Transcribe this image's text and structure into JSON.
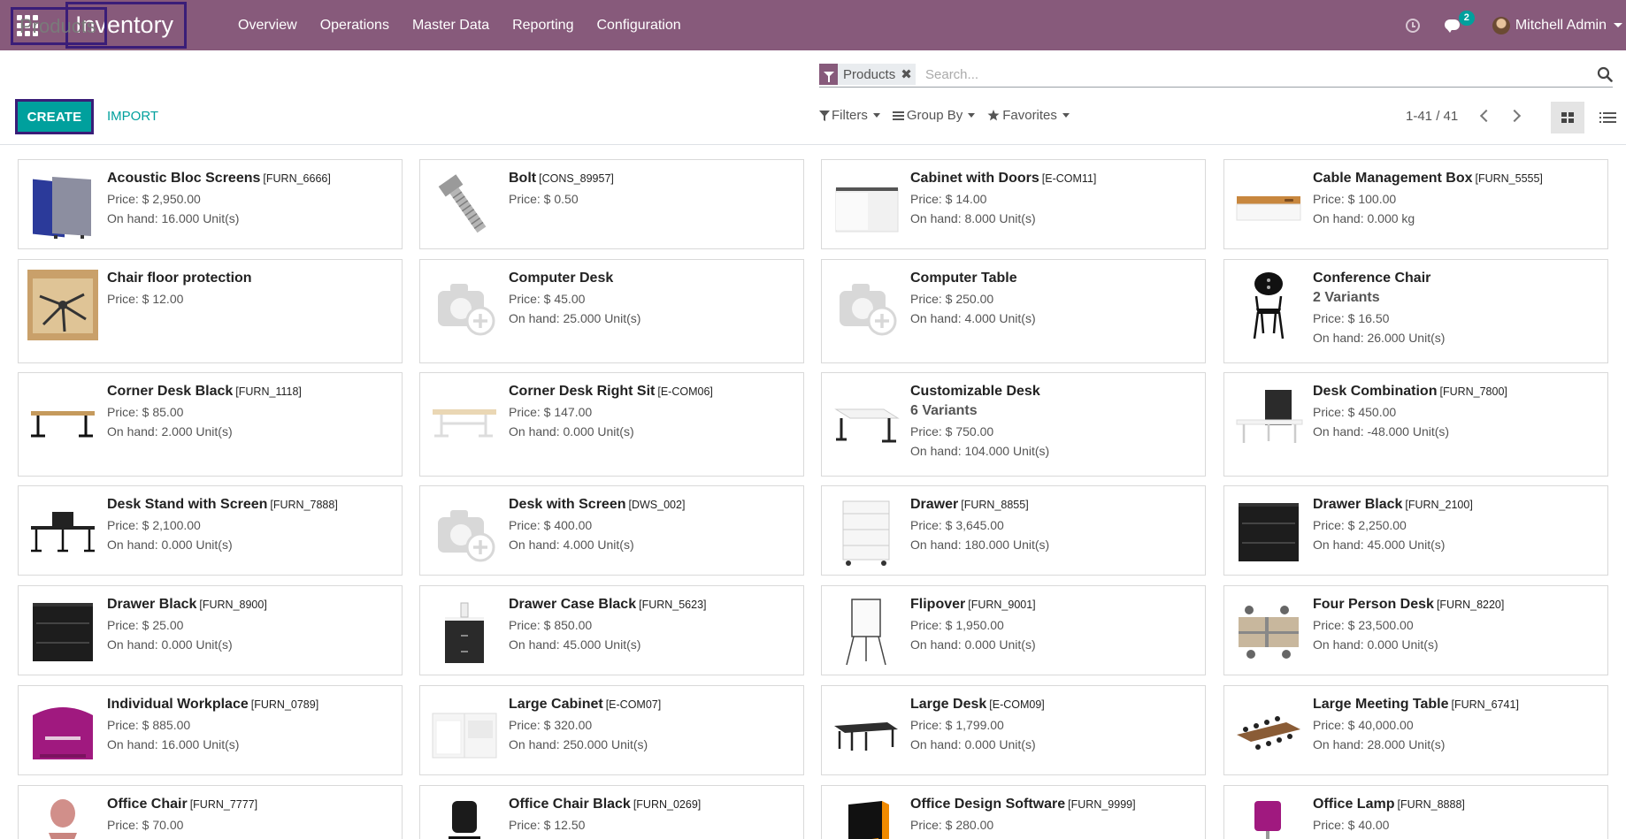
{
  "app": {
    "brand": "Inventory",
    "menu": [
      "Overview",
      "Operations",
      "Master Data",
      "Reporting",
      "Configuration"
    ],
    "message_count": "2",
    "user_name": "Mitchell Admin"
  },
  "control_panel": {
    "title": "Products",
    "create_label": "CREATE",
    "import_label": "IMPORT",
    "facet_label": "Products",
    "facet_remove": "✖",
    "search_placeholder": "Search...",
    "filters_label": "Filters",
    "groupby_label": "Group By",
    "favorites_label": "Favorites",
    "pager": "1-41 / 41"
  },
  "colors": {
    "brand": "#875a7b",
    "accent": "#00a09d"
  },
  "products": [
    {
      "name": "Acoustic Bloc Screens",
      "code": "[FURN_6666]",
      "variants": "",
      "price": "Price: $ 2,950.00",
      "onhand": "On hand: 16.000 Unit(s)",
      "image": "acoustic-screen"
    },
    {
      "name": "Bolt",
      "code": "[CONS_89957]",
      "variants": "",
      "price": "Price: $ 0.50",
      "onhand": "",
      "image": "bolt"
    },
    {
      "name": "Cabinet with Doors",
      "code": "[E-COM11]",
      "variants": "",
      "price": "Price: $ 14.00",
      "onhand": "On hand: 8.000 Unit(s)",
      "image": "cabinet-white"
    },
    {
      "name": "Cable Management Box",
      "code": "[FURN_5555]",
      "variants": "",
      "price": "Price: $ 100.00",
      "onhand": "On hand: 0.000 kg",
      "image": "cable-box"
    },
    {
      "name": "Chair floor protection",
      "code": "",
      "variants": "",
      "price": "Price: $ 12.00",
      "onhand": "",
      "image": "floor-protection"
    },
    {
      "name": "Computer Desk",
      "code": "",
      "variants": "",
      "price": "Price: $ 45.00",
      "onhand": "On hand: 25.000 Unit(s)",
      "image": "placeholder"
    },
    {
      "name": "Computer Table",
      "code": "",
      "variants": "",
      "price": "Price: $ 250.00",
      "onhand": "On hand: 4.000 Unit(s)",
      "image": "placeholder"
    },
    {
      "name": "Conference Chair",
      "code": "",
      "variants": "2 Variants",
      "price": "Price: $ 16.50",
      "onhand": "On hand: 26.000 Unit(s)",
      "image": "chair-black"
    },
    {
      "name": "Corner Desk Black",
      "code": "[FURN_1118]",
      "variants": "",
      "price": "Price: $ 85.00",
      "onhand": "On hand: 2.000 Unit(s)",
      "image": "desk-wood"
    },
    {
      "name": "Corner Desk Right Sit",
      "code": "[E-COM06]",
      "variants": "",
      "price": "Price: $ 147.00",
      "onhand": "On hand: 0.000 Unit(s)",
      "image": "desk-light"
    },
    {
      "name": "Customizable Desk",
      "code": "",
      "variants": "6 Variants",
      "price": "Price: $ 750.00",
      "onhand": "On hand: 104.000 Unit(s)",
      "image": "desk-white"
    },
    {
      "name": "Desk Combination",
      "code": "[FURN_7800]",
      "variants": "",
      "price": "Price: $ 450.00",
      "onhand": "On hand: -48.000 Unit(s)",
      "image": "desk-combo"
    },
    {
      "name": "Desk Stand with Screen",
      "code": "[FURN_7888]",
      "variants": "",
      "price": "Price: $ 2,100.00",
      "onhand": "On hand: 0.000 Unit(s)",
      "image": "desk-screen"
    },
    {
      "name": "Desk with Screen",
      "code": "[DWS_002]",
      "variants": "",
      "price": "Price: $ 400.00",
      "onhand": "On hand: 4.000 Unit(s)",
      "image": "placeholder"
    },
    {
      "name": "Drawer",
      "code": "[FURN_8855]",
      "variants": "",
      "price": "Price: $ 3,645.00",
      "onhand": "On hand: 180.000 Unit(s)",
      "image": "drawer-white"
    },
    {
      "name": "Drawer Black",
      "code": "[FURN_2100]",
      "variants": "",
      "price": "Price: $ 2,250.00",
      "onhand": "On hand: 45.000 Unit(s)",
      "image": "drawer-black"
    },
    {
      "name": "Drawer Black",
      "code": "[FURN_8900]",
      "variants": "",
      "price": "Price: $ 25.00",
      "onhand": "On hand: 0.000 Unit(s)",
      "image": "drawer-black"
    },
    {
      "name": "Drawer Case Black",
      "code": "[FURN_5623]",
      "variants": "",
      "price": "Price: $ 850.00",
      "onhand": "On hand: 45.000 Unit(s)",
      "image": "drawer-case"
    },
    {
      "name": "Flipover",
      "code": "[FURN_9001]",
      "variants": "",
      "price": "Price: $ 1,950.00",
      "onhand": "On hand: 0.000 Unit(s)",
      "image": "flipover"
    },
    {
      "name": "Four Person Desk",
      "code": "[FURN_8220]",
      "variants": "",
      "price": "Price: $ 23,500.00",
      "onhand": "On hand: 0.000 Unit(s)",
      "image": "four-desk"
    },
    {
      "name": "Individual Workplace",
      "code": "[FURN_0789]",
      "variants": "",
      "price": "Price: $ 885.00",
      "onhand": "On hand: 16.000 Unit(s)",
      "image": "workplace-purple"
    },
    {
      "name": "Large Cabinet",
      "code": "[E-COM07]",
      "variants": "",
      "price": "Price: $ 320.00",
      "onhand": "On hand: 250.000 Unit(s)",
      "image": "cabinet-large"
    },
    {
      "name": "Large Desk",
      "code": "[E-COM09]",
      "variants": "",
      "price": "Price: $ 1,799.00",
      "onhand": "On hand: 0.000 Unit(s)",
      "image": "desk-large"
    },
    {
      "name": "Large Meeting Table",
      "code": "[FURN_6741]",
      "variants": "",
      "price": "Price: $ 40,000.00",
      "onhand": "On hand: 28.000 Unit(s)",
      "image": "meeting-table"
    },
    {
      "name": "Office Chair",
      "code": "[FURN_7777]",
      "variants": "",
      "price": "Price: $ 70.00",
      "onhand": "",
      "image": "chair-pink"
    },
    {
      "name": "Office Chair Black",
      "code": "[FURN_0269]",
      "variants": "",
      "price": "Price: $ 12.50",
      "onhand": "",
      "image": "chair-office-black"
    },
    {
      "name": "Office Design Software",
      "code": "[FURN_9999]",
      "variants": "",
      "price": "Price: $ 280.00",
      "onhand": "",
      "image": "software-box"
    },
    {
      "name": "Office Lamp",
      "code": "[FURN_8888]",
      "variants": "",
      "price": "Price: $ 40.00",
      "onhand": "",
      "image": "lamp"
    }
  ]
}
